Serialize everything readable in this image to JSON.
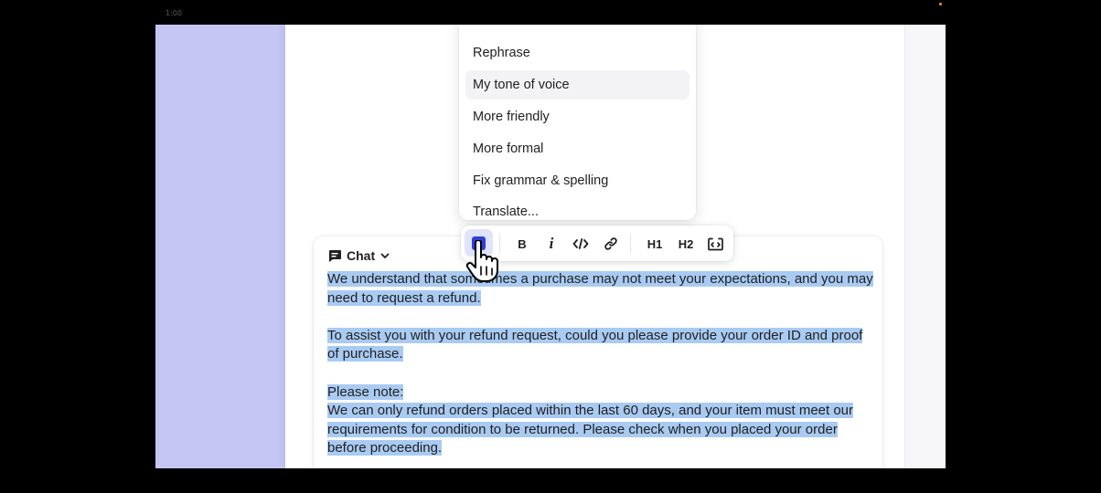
{
  "video": {
    "time": "1:00"
  },
  "menu": {
    "items": [
      {
        "label": "Rephrase",
        "highlighted": false
      },
      {
        "label": "My tone of voice",
        "highlighted": true
      },
      {
        "label": "More friendly",
        "highlighted": false
      },
      {
        "label": "More formal",
        "highlighted": false
      },
      {
        "label": "Fix grammar & spelling",
        "highlighted": false
      },
      {
        "label": "Translate...",
        "highlighted": false
      }
    ]
  },
  "composer": {
    "mode_label": "Chat",
    "paragraphs": [
      [
        "We understand that sometimes a purchase may not meet your expectations, and you may need to request a refund."
      ],
      [
        "To assist you with your refund request, could you please provide your order ID and proof of purchase."
      ],
      [
        "Please note:",
        "We can only refund orders placed within the last 60 days, and your item must meet our requirements for condition to be returned. Please check when you placed your order before proceeding."
      ]
    ]
  },
  "toolbar": {
    "buttons": [
      "ai-assist",
      "bold",
      "italic",
      "code",
      "link",
      "H1",
      "H2",
      "expand-code"
    ],
    "bold_label": "B",
    "italic_label": "i",
    "h1_label": "H1",
    "h2_label": "H2"
  },
  "colors": {
    "accent": "#2f3fd6",
    "selection": "#a9cbf2",
    "left_panel": "#c5c6f3"
  }
}
